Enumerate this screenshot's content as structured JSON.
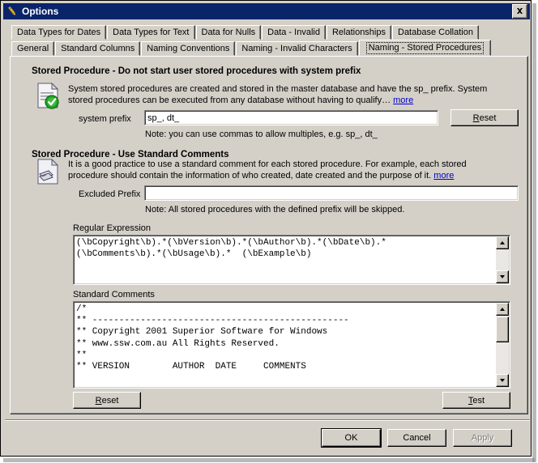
{
  "window": {
    "title": "Options",
    "icon": "pen-options-icon",
    "close_label": "✕"
  },
  "tabs": {
    "row1": [
      {
        "label": "Data Types for Dates",
        "selected": false
      },
      {
        "label": "Data Types for Text",
        "selected": false
      },
      {
        "label": "Data for Nulls",
        "selected": false
      },
      {
        "label": "Data - Invalid",
        "selected": false
      },
      {
        "label": "Relationships",
        "selected": false
      },
      {
        "label": "Database Collation",
        "selected": false
      }
    ],
    "row2": [
      {
        "label": "General",
        "selected": false
      },
      {
        "label": "Standard Columns",
        "selected": false
      },
      {
        "label": "Naming Conventions",
        "selected": false
      },
      {
        "label": "Naming - Invalid Characters",
        "selected": false
      },
      {
        "label": "Naming - Stored Procedures",
        "selected": true
      }
    ]
  },
  "section1": {
    "title": "Stored Procedure - Do not start user stored procedures with system prefix",
    "icon": "document-check-icon",
    "description_line1": "System stored procedures are created and stored in the master database and have the sp_ prefix. System",
    "description_line2": "stored procedures can be executed from any database without having to qualify…",
    "more_label": "more",
    "field_label": "system prefix",
    "field_value": "sp_, dt_",
    "field_placeholder": "",
    "reset_label": "Reset",
    "reset_accesskey": "R",
    "note": "Note: you can use commas to allow multiples, e.g. sp_, dt_"
  },
  "section2": {
    "title": "Stored Procedure - Use Standard Comments",
    "icon": "document-comments-icon",
    "description_line1": "It is a good practice to use a standard comment for each stored procedure. For example, each stored",
    "description_line2": "procedure should contain the information of who created, date created and the purpose of it.",
    "more_label": "more",
    "field_label": "Excluded Prefix",
    "field_value": "",
    "field_placeholder": "",
    "note": "Note: All stored procedures with the defined prefix will be skipped."
  },
  "regex": {
    "label": "Regular Expression",
    "value": "(\\bCopyright\\b).*(\\bVersion\\b).*(\\bAuthor\\b).*(\\bDate\\b).*\n(\\bComments\\b).*(\\bUsage\\b).*  (\\bExample\\b)",
    "scroll_up_icon": "scroll-up-arrow-icon",
    "scroll_down_icon": "scroll-down-arrow-icon"
  },
  "comments": {
    "label": "Standard Comments",
    "value": "/*\n** ------------------------------------------------\n** Copyright 2001 Superior Software for Windows\n** www.ssw.com.au All Rights Reserved.\n**\n** VERSION        AUTHOR  DATE     COMMENTS",
    "scroll_up_icon": "scroll-up-arrow-icon",
    "scroll_down_icon": "scroll-down-arrow-icon"
  },
  "actions": {
    "reset_label": "Reset",
    "test_label": "Test"
  },
  "footer": {
    "ok_label": "OK",
    "cancel_label": "Cancel",
    "apply_label": "Apply",
    "apply_disabled": true
  },
  "colors": {
    "titlebar": "#0a246a",
    "face": "#d4d0c8",
    "link": "#0000cc",
    "field_bg": "#ffffff",
    "disabled_text": "#808080"
  }
}
